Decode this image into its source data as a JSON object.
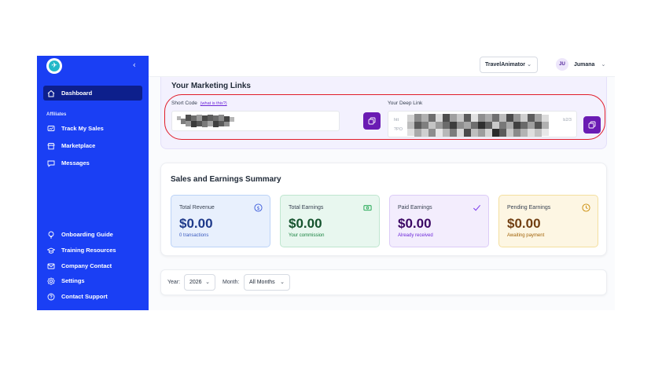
{
  "sidebar": {
    "section_label": "Affiliates",
    "items": [
      {
        "label": "Dashboard",
        "icon": "home-icon"
      },
      {
        "label": "Track My Sales",
        "icon": "chart-icon"
      },
      {
        "label": "Marketplace",
        "icon": "storefront-icon"
      },
      {
        "label": "Messages",
        "icon": "chat-icon"
      },
      {
        "label": "Onboarding Guide",
        "icon": "lightbulb-icon"
      },
      {
        "label": "Training Resources",
        "icon": "graduation-cap-icon"
      },
      {
        "label": "Company Contact",
        "icon": "mail-icon"
      },
      {
        "label": "Settings",
        "icon": "gear-icon"
      },
      {
        "label": "Contact Support",
        "icon": "help-circle-icon"
      }
    ],
    "colors": {
      "background": "#1a3ff4",
      "active": "#0d1f8c"
    }
  },
  "topbar": {
    "workspace": "TravelAnimator",
    "user_initials": "JU",
    "user_name": "Jumana"
  },
  "marketing_links": {
    "title": "Your Marketing Links",
    "short_code_label": "Short Code",
    "short_code_help": "(what is this?)",
    "deep_link_label": "Your Deep Link",
    "deep_link_prefix_1": "htt",
    "deep_link_prefix_2": "?PO",
    "deep_link_suffix": "b2/3"
  },
  "summary": {
    "title": "Sales and Earnings Summary",
    "cards": [
      {
        "label": "Total Revenue",
        "value": "$0.00",
        "sub": "0 transactions",
        "icon": "dollar-circle-icon",
        "bg": "#e8f0fd",
        "border": "#bcd3f7",
        "value_color": "#1e3a8a",
        "sub_color": "#3b5bbf"
      },
      {
        "label": "Total Earnings",
        "value": "$0.00",
        "sub": "Your commission",
        "icon": "cash-icon",
        "bg": "#e8f7ef",
        "border": "#bfe6cf",
        "value_color": "#14532d",
        "sub_color": "#15803d"
      },
      {
        "label": "Paid Earnings",
        "value": "$0.00",
        "sub": "Already received",
        "icon": "check-icon",
        "bg": "#f3edfd",
        "border": "#dccbf7",
        "value_color": "#3b0764",
        "sub_color": "#6d28d9"
      },
      {
        "label": "Pending Earnings",
        "value": "$0.00",
        "sub": "Awaiting payment",
        "icon": "clock-icon",
        "bg": "#fdf6e3",
        "border": "#f4df9f",
        "value_color": "#713f12",
        "sub_color": "#a16207"
      }
    ]
  },
  "filters": {
    "year_label": "Year:",
    "year_value": "2026",
    "month_label": "Month:",
    "month_value": "All Months"
  }
}
